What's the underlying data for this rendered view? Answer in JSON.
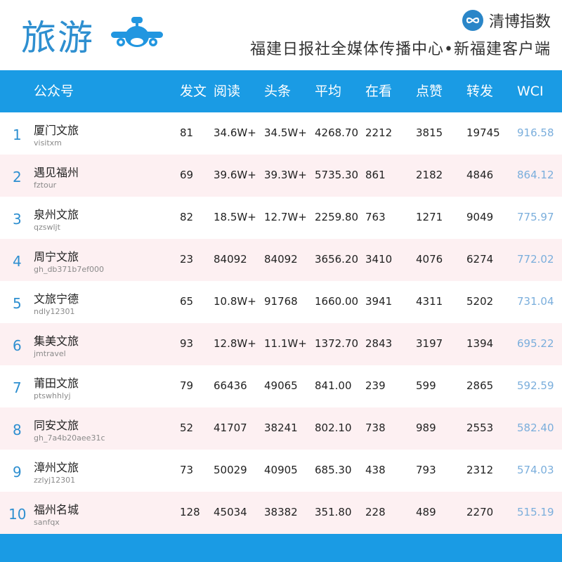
{
  "header": {
    "title": "旅游",
    "brand_name": "清博指数",
    "subtitle": "福建日报社全媒体传播中心•新福建客户端",
    "colors": {
      "accent": "#1a9be4",
      "title": "#2e8fd0",
      "wci": "#7aaedc",
      "alt_row": "#fdf0f2"
    },
    "icons": {
      "title_icon": "airplane-icon",
      "brand_icon": "infinity-logo-icon"
    }
  },
  "table": {
    "columns": [
      "公众号",
      "发文",
      "阅读",
      "头条",
      "平均",
      "在看",
      "点赞",
      "转发",
      "WCI"
    ],
    "rows": [
      {
        "rank": "1",
        "name": "厦门文旅",
        "account": "visitxm",
        "posts": "81",
        "reads": "34.6W+",
        "headline": "34.5W+",
        "avg": "4268.70",
        "watching": "2212",
        "likes": "3815",
        "shares": "19745",
        "wci": "916.58"
      },
      {
        "rank": "2",
        "name": "遇见福州",
        "account": "fztour",
        "posts": "69",
        "reads": "39.6W+",
        "headline": "39.3W+",
        "avg": "5735.30",
        "watching": "861",
        "likes": "2182",
        "shares": "4846",
        "wci": "864.12"
      },
      {
        "rank": "3",
        "name": "泉州文旅",
        "account": "qzswljt",
        "posts": "82",
        "reads": "18.5W+",
        "headline": "12.7W+",
        "avg": "2259.80",
        "watching": "763",
        "likes": "1271",
        "shares": "9049",
        "wci": "775.97"
      },
      {
        "rank": "4",
        "name": "周宁文旅",
        "account": "gh_db371b7ef000",
        "posts": "23",
        "reads": "84092",
        "headline": "84092",
        "avg": "3656.20",
        "watching": "3410",
        "likes": "4076",
        "shares": "6274",
        "wci": "772.02"
      },
      {
        "rank": "5",
        "name": "文旅宁德",
        "account": "ndly12301",
        "posts": "65",
        "reads": "10.8W+",
        "headline": "91768",
        "avg": "1660.00",
        "watching": "3941",
        "likes": "4311",
        "shares": "5202",
        "wci": "731.04"
      },
      {
        "rank": "6",
        "name": "集美文旅",
        "account": "jmtravel",
        "posts": "93",
        "reads": "12.8W+",
        "headline": "11.1W+",
        "avg": "1372.70",
        "watching": "2843",
        "likes": "3197",
        "shares": "1394",
        "wci": "695.22"
      },
      {
        "rank": "7",
        "name": "莆田文旅",
        "account": "ptswhhlyj",
        "posts": "79",
        "reads": "66436",
        "headline": "49065",
        "avg": "841.00",
        "watching": "239",
        "likes": "599",
        "shares": "2865",
        "wci": "592.59"
      },
      {
        "rank": "8",
        "name": "同安文旅",
        "account": "gh_7a4b20aee31c",
        "posts": "52",
        "reads": "41707",
        "headline": "38241",
        "avg": "802.10",
        "watching": "738",
        "likes": "989",
        "shares": "2553",
        "wci": "582.40"
      },
      {
        "rank": "9",
        "name": "漳州文旅",
        "account": "zzlyj12301",
        "posts": "73",
        "reads": "50029",
        "headline": "40905",
        "avg": "685.30",
        "watching": "438",
        "likes": "793",
        "shares": "2312",
        "wci": "574.03"
      },
      {
        "rank": "10",
        "name": "福州名城",
        "account": "sanfqx",
        "posts": "128",
        "reads": "45034",
        "headline": "38382",
        "avg": "351.80",
        "watching": "228",
        "likes": "489",
        "shares": "2270",
        "wci": "515.19"
      }
    ]
  }
}
